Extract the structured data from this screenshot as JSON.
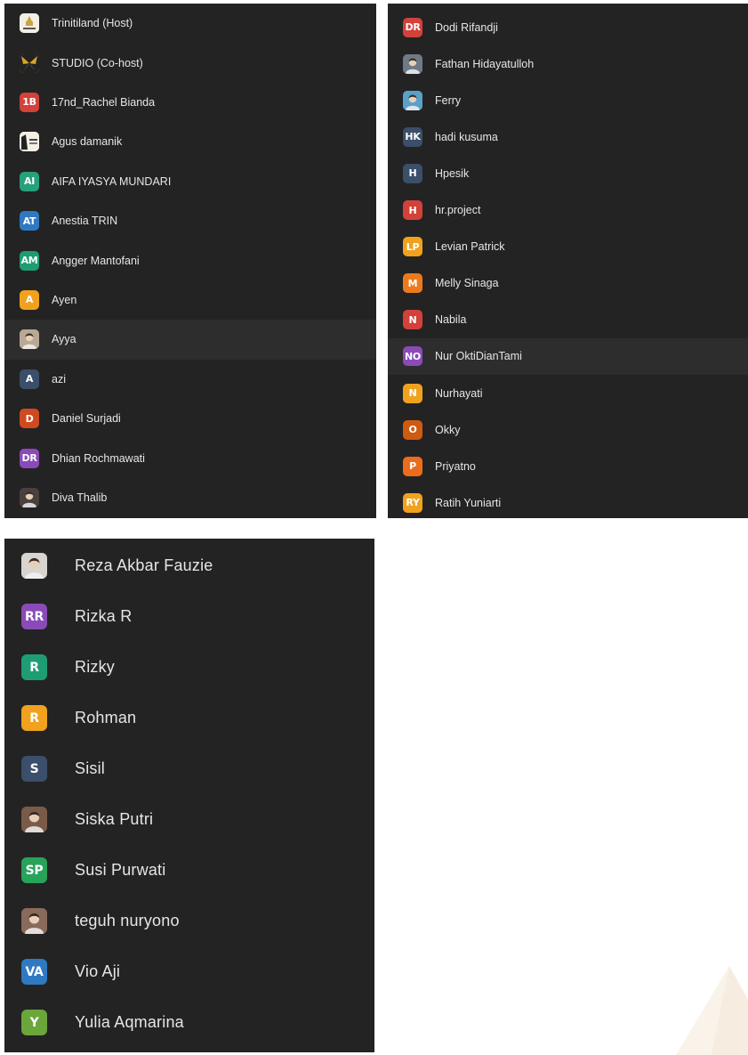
{
  "panels": [
    {
      "participants": [
        {
          "name": "Trinitiland (Host)",
          "avatar": {
            "kind": "logo",
            "color": "#f4efe4",
            "icon": "trinity-logo-icon"
          }
        },
        {
          "name": "STUDIO (Co-host)",
          "avatar": {
            "kind": "photo",
            "color": "#d9a428",
            "icon": "butterfly-icon"
          }
        },
        {
          "name": "17nd_Rachel Bianda",
          "avatar": {
            "kind": "initials",
            "initials": "1B",
            "color": "#d2413a"
          }
        },
        {
          "name": "Agus damanik",
          "avatar": {
            "kind": "logo",
            "color": "#f4efe4",
            "icon": "trinity-land-logo-icon"
          }
        },
        {
          "name": "AIFA IYASYA MUNDARI",
          "avatar": {
            "kind": "initials",
            "initials": "AI",
            "color": "#27a07c"
          }
        },
        {
          "name": "Anestia TRIN",
          "avatar": {
            "kind": "initials",
            "initials": "AT",
            "color": "#2f79c3"
          }
        },
        {
          "name": "Angger Mantofani",
          "avatar": {
            "kind": "initials",
            "initials": "AM",
            "color": "#1e9d74"
          }
        },
        {
          "name": "Ayen",
          "avatar": {
            "kind": "initials",
            "initials": "A",
            "color": "#f0a21e"
          }
        },
        {
          "name": "Ayya",
          "avatar": {
            "kind": "photo",
            "color": "#b8a896",
            "icon": "person-photo-icon"
          },
          "highlighted": true
        },
        {
          "name": "azi",
          "avatar": {
            "kind": "initials",
            "initials": "A",
            "color": "#3b4e6a"
          }
        },
        {
          "name": "Daniel Surjadi",
          "avatar": {
            "kind": "initials",
            "initials": "D",
            "color": "#cf4a1f"
          }
        },
        {
          "name": "Dhian Rochmawati",
          "avatar": {
            "kind": "initials",
            "initials": "DR",
            "color": "#8a4bb8"
          }
        },
        {
          "name": "Diva Thalib",
          "avatar": {
            "kind": "photo",
            "color": "#4a4040",
            "icon": "person-photo-icon"
          }
        }
      ]
    },
    {
      "participants": [
        {
          "name": "Dodi Rifandji",
          "avatar": {
            "kind": "initials",
            "initials": "DR",
            "color": "#d2413a"
          }
        },
        {
          "name": "Fathan Hidayatulloh",
          "avatar": {
            "kind": "photo",
            "color": "#6e7a86",
            "icon": "person-photo-icon"
          }
        },
        {
          "name": "Ferry",
          "avatar": {
            "kind": "photo",
            "color": "#5aa0c8",
            "icon": "person-photo-icon"
          }
        },
        {
          "name": "hadi kusuma",
          "avatar": {
            "kind": "initials",
            "initials": "HK",
            "color": "#3b4e6a"
          }
        },
        {
          "name": "Hpesik",
          "avatar": {
            "kind": "initials",
            "initials": "H",
            "color": "#3b4e6a"
          }
        },
        {
          "name": "hr.project",
          "avatar": {
            "kind": "initials",
            "initials": "H",
            "color": "#d2413a"
          }
        },
        {
          "name": "Levian Patrick",
          "avatar": {
            "kind": "initials",
            "initials": "LP",
            "color": "#f0a21e"
          }
        },
        {
          "name": "Melly Sinaga",
          "avatar": {
            "kind": "initials",
            "initials": "M",
            "color": "#ec7a1c"
          }
        },
        {
          "name": "Nabila",
          "avatar": {
            "kind": "initials",
            "initials": "N",
            "color": "#d2413a"
          }
        },
        {
          "name": "Nur OktiDianTami",
          "avatar": {
            "kind": "initials",
            "initials": "NO",
            "color": "#8a4bb8"
          },
          "highlighted": true
        },
        {
          "name": "Nurhayati",
          "avatar": {
            "kind": "initials",
            "initials": "N",
            "color": "#f0a21e"
          }
        },
        {
          "name": "Okky",
          "avatar": {
            "kind": "initials",
            "initials": "O",
            "color": "#cf5a12"
          }
        },
        {
          "name": "Priyatno",
          "avatar": {
            "kind": "initials",
            "initials": "P",
            "color": "#ec6c1c"
          }
        },
        {
          "name": "Ratih Yuniarti",
          "avatar": {
            "kind": "initials",
            "initials": "RY",
            "color": "#f0a21e"
          }
        }
      ]
    },
    {
      "participants": [
        {
          "name": "Reza Akbar Fauzie",
          "avatar": {
            "kind": "photo",
            "color": "#d8d4cf",
            "icon": "person-photo-icon"
          }
        },
        {
          "name": "Rizka R",
          "avatar": {
            "kind": "initials",
            "initials": "RR",
            "color": "#8a4bb8"
          }
        },
        {
          "name": "Rizky",
          "avatar": {
            "kind": "initials",
            "initials": "R",
            "color": "#1e9d74"
          }
        },
        {
          "name": "Rohman",
          "avatar": {
            "kind": "initials",
            "initials": "R",
            "color": "#f0a21e"
          }
        },
        {
          "name": "Sisil",
          "avatar": {
            "kind": "initials",
            "initials": "S",
            "color": "#3b4e6a"
          }
        },
        {
          "name": "Siska Putri",
          "avatar": {
            "kind": "photo",
            "color": "#7a5a48",
            "icon": "person-photo-icon"
          }
        },
        {
          "name": "Susi Purwati",
          "avatar": {
            "kind": "initials",
            "initials": "SP",
            "color": "#27a35a"
          }
        },
        {
          "name": "teguh nuryono",
          "avatar": {
            "kind": "photo",
            "color": "#8a6a5a",
            "icon": "person-photo-icon"
          }
        },
        {
          "name": "Vio Aji",
          "avatar": {
            "kind": "initials",
            "initials": "VA",
            "color": "#2f79c3"
          }
        },
        {
          "name": "Yulia Aqmarina",
          "avatar": {
            "kind": "initials",
            "initials": "Y",
            "color": "#6aa63a"
          }
        }
      ]
    }
  ]
}
